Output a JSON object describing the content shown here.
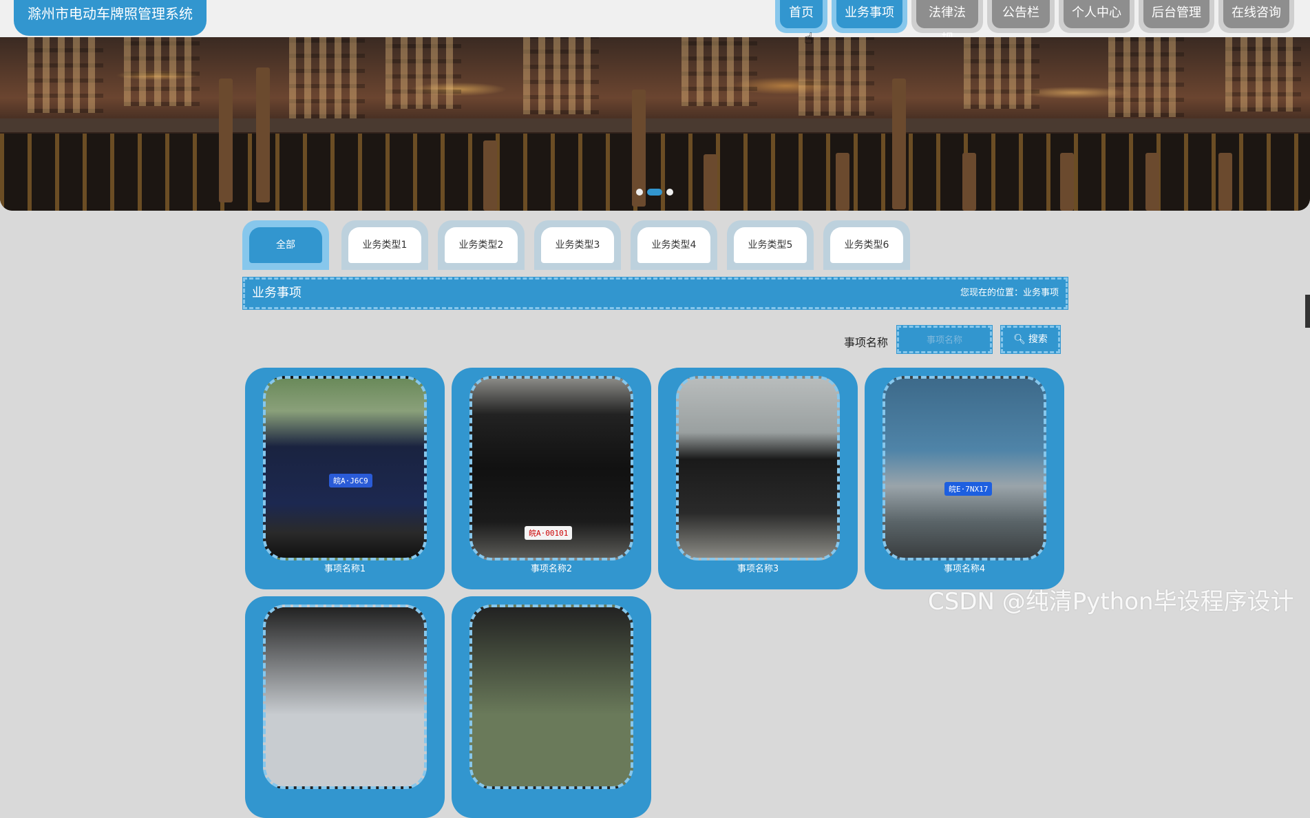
{
  "header": {
    "site_title": "滁州市电动车牌照管理系统",
    "nav": [
      {
        "label": "首页",
        "active": true
      },
      {
        "label": "业务事项",
        "active": true
      },
      {
        "label": "法律法规",
        "active": false
      },
      {
        "label": "公告栏",
        "active": false
      },
      {
        "label": "个人中心",
        "active": false
      },
      {
        "label": "后台管理",
        "active": false
      },
      {
        "label": "在线咨询",
        "active": false
      }
    ]
  },
  "banner": {
    "slide_count": 3,
    "active_slide": 2
  },
  "category_tabs": [
    "全部",
    "业务类型1",
    "业务类型2",
    "业务类型3",
    "业务类型4",
    "业务类型5",
    "业务类型6"
  ],
  "active_tab": "全部",
  "section": {
    "title": "业务事项",
    "breadcrumb_label": "您现在的位置：",
    "breadcrumb_value": "业务事项"
  },
  "search": {
    "label": "事项名称",
    "placeholder": "事项名称",
    "button_label": "搜索"
  },
  "items": [
    {
      "caption": "事项名称1",
      "plate": "皖A·J6C9"
    },
    {
      "caption": "事项名称2",
      "plate": "皖A·00101"
    },
    {
      "caption": "事项名称3",
      "plate": ""
    },
    {
      "caption": "事项名称4",
      "plate": "皖E·7NX17"
    }
  ],
  "watermark": "CSDN @纯清Python毕设程序设计",
  "colors": {
    "primary": "#3296cf",
    "accent": "#87c7ec",
    "inactive_nav": "#8e8e8e",
    "page_bg": "#d9d9d9"
  }
}
